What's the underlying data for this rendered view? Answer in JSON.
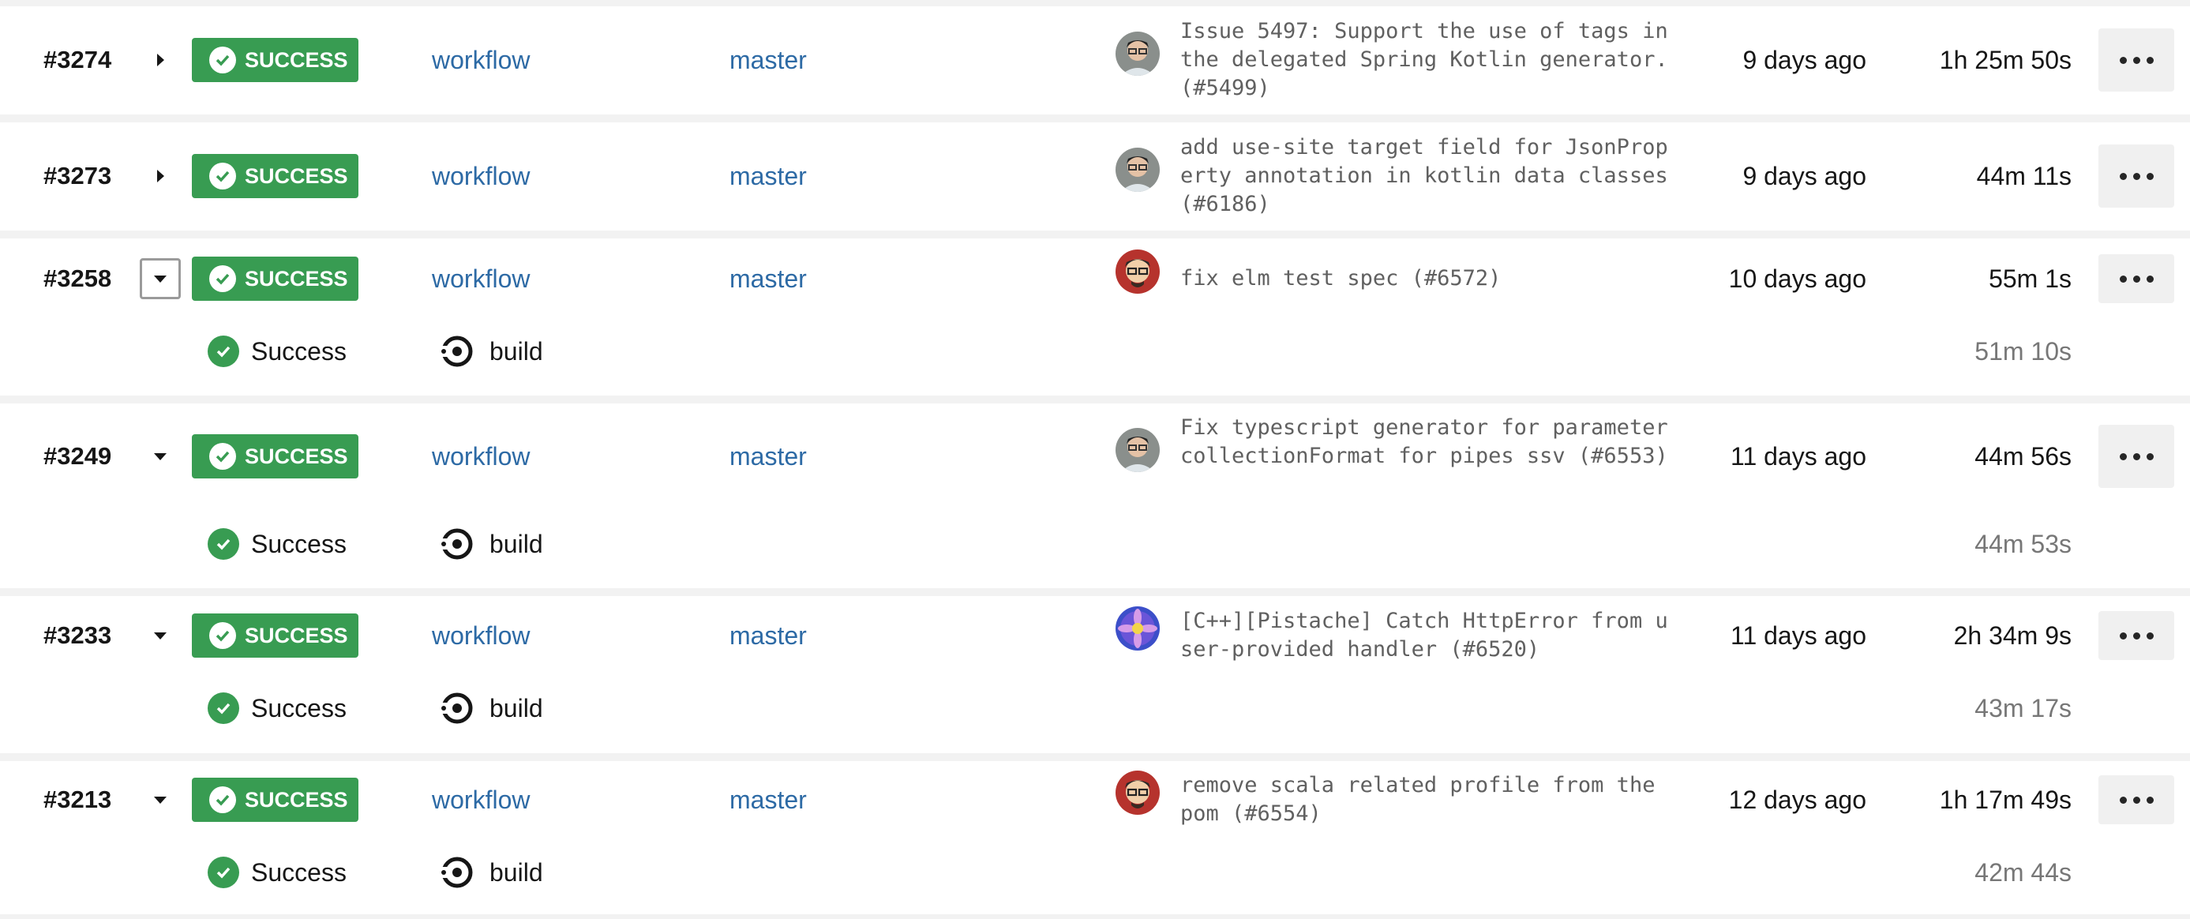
{
  "pipelines": [
    {
      "number": "#3274",
      "expanded": false,
      "status": "SUCCESS",
      "workflow": "workflow",
      "branch": "master",
      "avatar": "avatar-person-a",
      "commit": "Issue 5497: Support the use of tags in the delegated Spring Kotlin generator. (#5499)",
      "ago": "9 days ago",
      "duration": "1h 25m 50s"
    },
    {
      "number": "#3273",
      "expanded": false,
      "status": "SUCCESS",
      "workflow": "workflow",
      "branch": "master",
      "avatar": "avatar-person-a",
      "commit": "add use-site target field for JsonProperty annotation in kotlin data classes (#6186)",
      "ago": "9 days ago",
      "duration": "44m 11s"
    },
    {
      "number": "#3258",
      "expanded": true,
      "status": "SUCCESS",
      "workflow": "workflow",
      "branch": "master",
      "avatar": "avatar-person-b",
      "commit": "fix elm test spec (#6572)",
      "ago": "10 days ago",
      "duration": "55m 1s",
      "job": {
        "status": "Success",
        "name": "build",
        "duration": "51m 10s"
      }
    },
    {
      "number": "#3249",
      "expanded": true,
      "status": "SUCCESS",
      "workflow": "workflow",
      "branch": "master",
      "avatar": "avatar-person-a",
      "commit": "Fix typescript generator for parameter collectionFormat for pipes ssv (#6553)",
      "ago": "11 days ago",
      "duration": "44m 56s",
      "job": {
        "status": "Success",
        "name": "build",
        "duration": "44m 53s"
      }
    },
    {
      "number": "#3233",
      "expanded": true,
      "status": "SUCCESS",
      "workflow": "workflow",
      "branch": "master",
      "avatar": "avatar-flower",
      "commit": "[C++][Pistache] Catch HttpError from user-provided handler (#6520)",
      "ago": "11 days ago",
      "duration": "2h 34m 9s",
      "job": {
        "status": "Success",
        "name": "build",
        "duration": "43m 17s"
      }
    },
    {
      "number": "#3213",
      "expanded": true,
      "status": "SUCCESS",
      "workflow": "workflow",
      "branch": "master",
      "avatar": "avatar-person-b",
      "commit": "remove scala related profile from the pom (#6554)",
      "ago": "12 days ago",
      "duration": "1h 17m 49s",
      "job": {
        "status": "Success",
        "name": "build",
        "duration": "42m 44s"
      }
    }
  ],
  "colors": {
    "success": "#389c52",
    "link": "#2d6aa5",
    "muted": "#777777"
  },
  "icons": {
    "expand": "caret-right-icon",
    "collapse": "caret-down-icon",
    "status": "check-circle-icon",
    "job": "circleci-icon",
    "menu": "more-dots-icon"
  }
}
